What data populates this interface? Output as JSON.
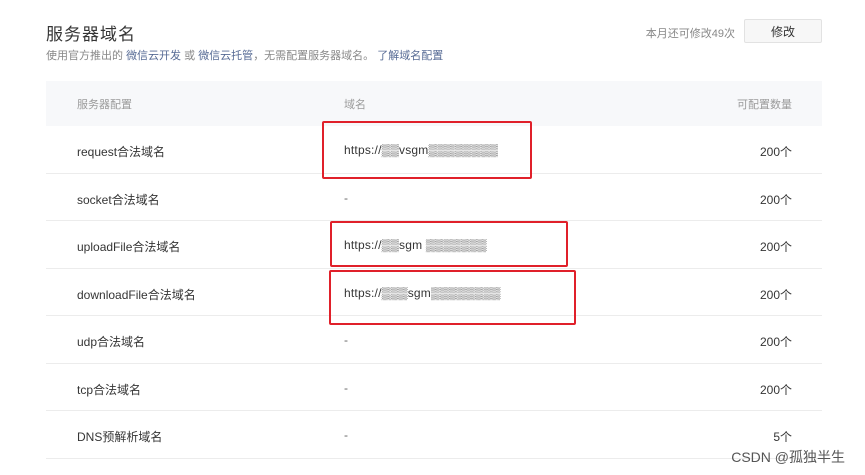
{
  "header": {
    "title": "服务器域名",
    "desc_prefix": "使用官方推出的",
    "link_dev": "微信云开发",
    "desc_or": "或",
    "link_host": "微信云托管",
    "desc_mid": "，无需配置服务器域名。",
    "link_learn": "了解域名配置",
    "quota": "本月还可修改49次",
    "modify_label": "修改"
  },
  "table": {
    "columns": [
      "服务器配置",
      "域名",
      "可配置数量"
    ],
    "rows": [
      {
        "name": "request合法域名",
        "domain": "https://▒▒vsgm▒▒▒▒▒▒▒▒",
        "count": "200个"
      },
      {
        "name": "socket合法域名",
        "domain": "-",
        "count": "200个"
      },
      {
        "name": "uploadFile合法域名",
        "domain": "https://▒▒sgm ▒▒▒▒▒▒▒",
        "count": "200个"
      },
      {
        "name": "downloadFile合法域名",
        "domain": "https://▒▒▒sgm▒▒▒▒▒▒▒▒",
        "count": "200个"
      },
      {
        "name": "udp合法域名",
        "domain": "-",
        "count": "200个"
      },
      {
        "name": "tcp合法域名",
        "domain": "-",
        "count": "200个"
      },
      {
        "name": "DNS预解析域名",
        "domain": "-",
        "count": "5个"
      }
    ]
  },
  "watermark": "CSDN @孤独半生",
  "colors": {
    "highlight": "#e0202a",
    "link": "#576b95"
  }
}
